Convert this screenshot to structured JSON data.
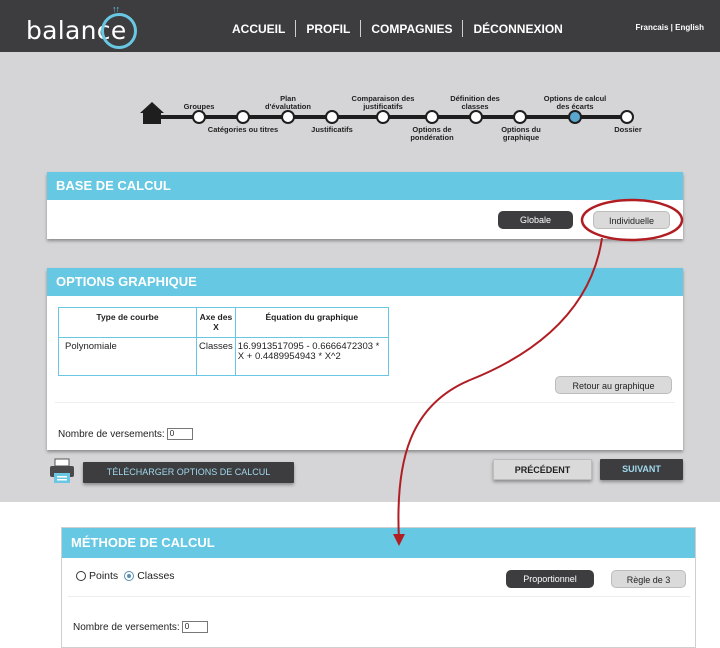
{
  "header": {
    "logo_text": "balance",
    "nav": [
      "ACCUEIL",
      "PROFIL",
      "COMPAGNIES",
      "DÉCONNEXION"
    ],
    "lang_fr": "Francais",
    "lang_sep": " | ",
    "lang_en": "English"
  },
  "stepper": {
    "active_index": 9,
    "steps": [
      {
        "label": "Groupes"
      },
      {
        "label": "Catégories ou titres"
      },
      {
        "label": "Plan d'évalutation"
      },
      {
        "label": "Justificatifs"
      },
      {
        "label": "Comparaison des justificatifs"
      },
      {
        "label": "Options de pondération"
      },
      {
        "label": "Définition des classes"
      },
      {
        "label": "Options du graphique"
      },
      {
        "label": "Options de calcul des écarts"
      },
      {
        "label": "Dossier"
      }
    ]
  },
  "base_calcul": {
    "title": "BASE DE CALCUL",
    "btn_globale": "Globale",
    "btn_individuelle": "Individuelle"
  },
  "options_graphique": {
    "title": "OPTIONS GRAPHIQUE",
    "headers": [
      "Type de courbe",
      "Axe des X",
      "Équation du graphique"
    ],
    "row": [
      "Polynomiale",
      "Classes",
      "16.9913517095 - 0.6666472303 * X + 0.4489954943 * X^2"
    ],
    "btn_retour": "Retour au graphique",
    "versements_label": "Nombre de versements:",
    "versements_value": "0"
  },
  "actions": {
    "telecharger": "TÉLÉCHARGER OPTIONS DE CALCUL",
    "precedent": "PRÉCÉDENT",
    "suivant": "SUIVANT"
  },
  "methode": {
    "title": "MÉTHODE DE CALCUL",
    "radio_points": "Points",
    "radio_classes": "Classes",
    "selected": "Classes",
    "btn_proportionnel": "Proportionnel",
    "btn_regle": "Règle de 3",
    "versements_label": "Nombre de versements:",
    "versements_value": "0"
  },
  "colors": {
    "header_bg": "#3d3d3f",
    "accent_blue": "#66c8e3",
    "annotation_red": "#b01e24",
    "grey_bg": "#d5d5d7"
  }
}
